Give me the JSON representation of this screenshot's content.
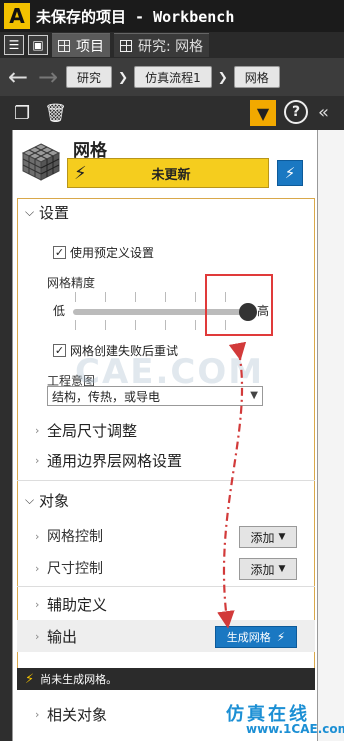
{
  "window": {
    "logo_letter": "A",
    "title": "未保存的项目 - Workbench"
  },
  "tabs": [
    {
      "label": "项目"
    },
    {
      "label": "研究: 网格"
    }
  ],
  "breadcrumb": {
    "items": [
      "研究",
      "仿真流程1",
      "网格"
    ]
  },
  "toolbar": {
    "filter_icon": "filter-icon",
    "help_label": "?",
    "collapse_label": "«"
  },
  "panel": {
    "title": "网格",
    "status": "未更新",
    "settings": {
      "label": "设置",
      "use_preset_label": "使用预定义设置",
      "use_preset_checked": true,
      "mesh_precision_label": "网格精度",
      "slider_low": "低",
      "slider_high": "高",
      "slider_level": 1.0,
      "retry_label": "网格创建失败后重试",
      "retry_checked": true,
      "engineering_intent_label": "工程意图",
      "engineering_intent_value": "结构，传热，或导电"
    },
    "global_size": "全局尺寸调整",
    "boundary_layer": "通用边界层网格设置",
    "objects": {
      "label": "对象",
      "mesh_control": "网格控制",
      "size_control": "尺寸控制",
      "add_label": "添加"
    },
    "aux_def": "辅助定义",
    "output": {
      "label": "输出",
      "generate_label": "生成网格"
    },
    "message": "尚未生成网格。",
    "related": "相关对象"
  },
  "watermarks": {
    "center": "CAE.COM",
    "brand_line1": "仿真在线",
    "brand_line2": "www.1CAE.com"
  },
  "colors": {
    "accent_yellow": "#f5cd1e",
    "action_blue": "#1a78c2",
    "highlight_red": "#e03a3a",
    "frame_orange": "#d9a84a"
  }
}
